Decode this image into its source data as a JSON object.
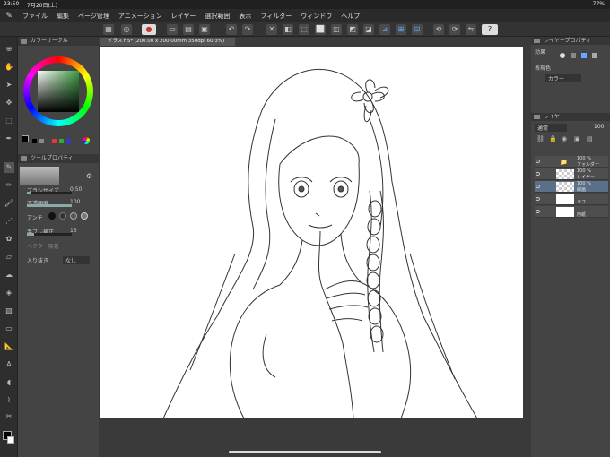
{
  "status": {
    "time": "23:50",
    "date": "7月20日(土)",
    "battery": "77%"
  },
  "menu": [
    "ファイル",
    "編集",
    "ページ管理",
    "アニメーション",
    "レイヤー",
    "選択範囲",
    "表示",
    "フィルター",
    "ウィンドウ",
    "ヘルプ"
  ],
  "panels": {
    "color_circle": "カラーサークル",
    "tool_property": "ツールプロパティ",
    "layer_property": "レイヤープロパティ",
    "layer": "レイヤー"
  },
  "tool_property": {
    "brush_size_label": "ブラシサイズ",
    "brush_size_value": "0.50",
    "opacity_label": "不透明度",
    "opacity_value": "100",
    "antialias_label": "アンチ",
    "stabilization_label": "手ブレ補正",
    "stabilization_value": "15",
    "vector_label": "ベクター吸着",
    "taper_label": "入り抜き",
    "taper_value": "なし"
  },
  "document_tab": "イラスト5* (200.00 x 200.00mm 350dpi 60.3%)",
  "layer_property": {
    "effect_label": "効果",
    "expression_label": "表現色",
    "expression_value": "カラー"
  },
  "layer_panel": {
    "blend": "通常",
    "opacity": "100"
  },
  "layers": [
    {
      "percent": "100 %",
      "name": "フォルダー",
      "selected": false
    },
    {
      "percent": "100 %",
      "name": "レイヤー",
      "selected": false
    },
    {
      "percent": "100 %",
      "name": "線画",
      "selected": true
    },
    {
      "percent": "",
      "name": "ラフ",
      "selected": false
    },
    {
      "percent": "",
      "name": "用紙",
      "selected": false
    }
  ],
  "colors": {
    "accent": "#5a6f88",
    "main_color": "#000000",
    "sub_color": "#ffffff"
  }
}
